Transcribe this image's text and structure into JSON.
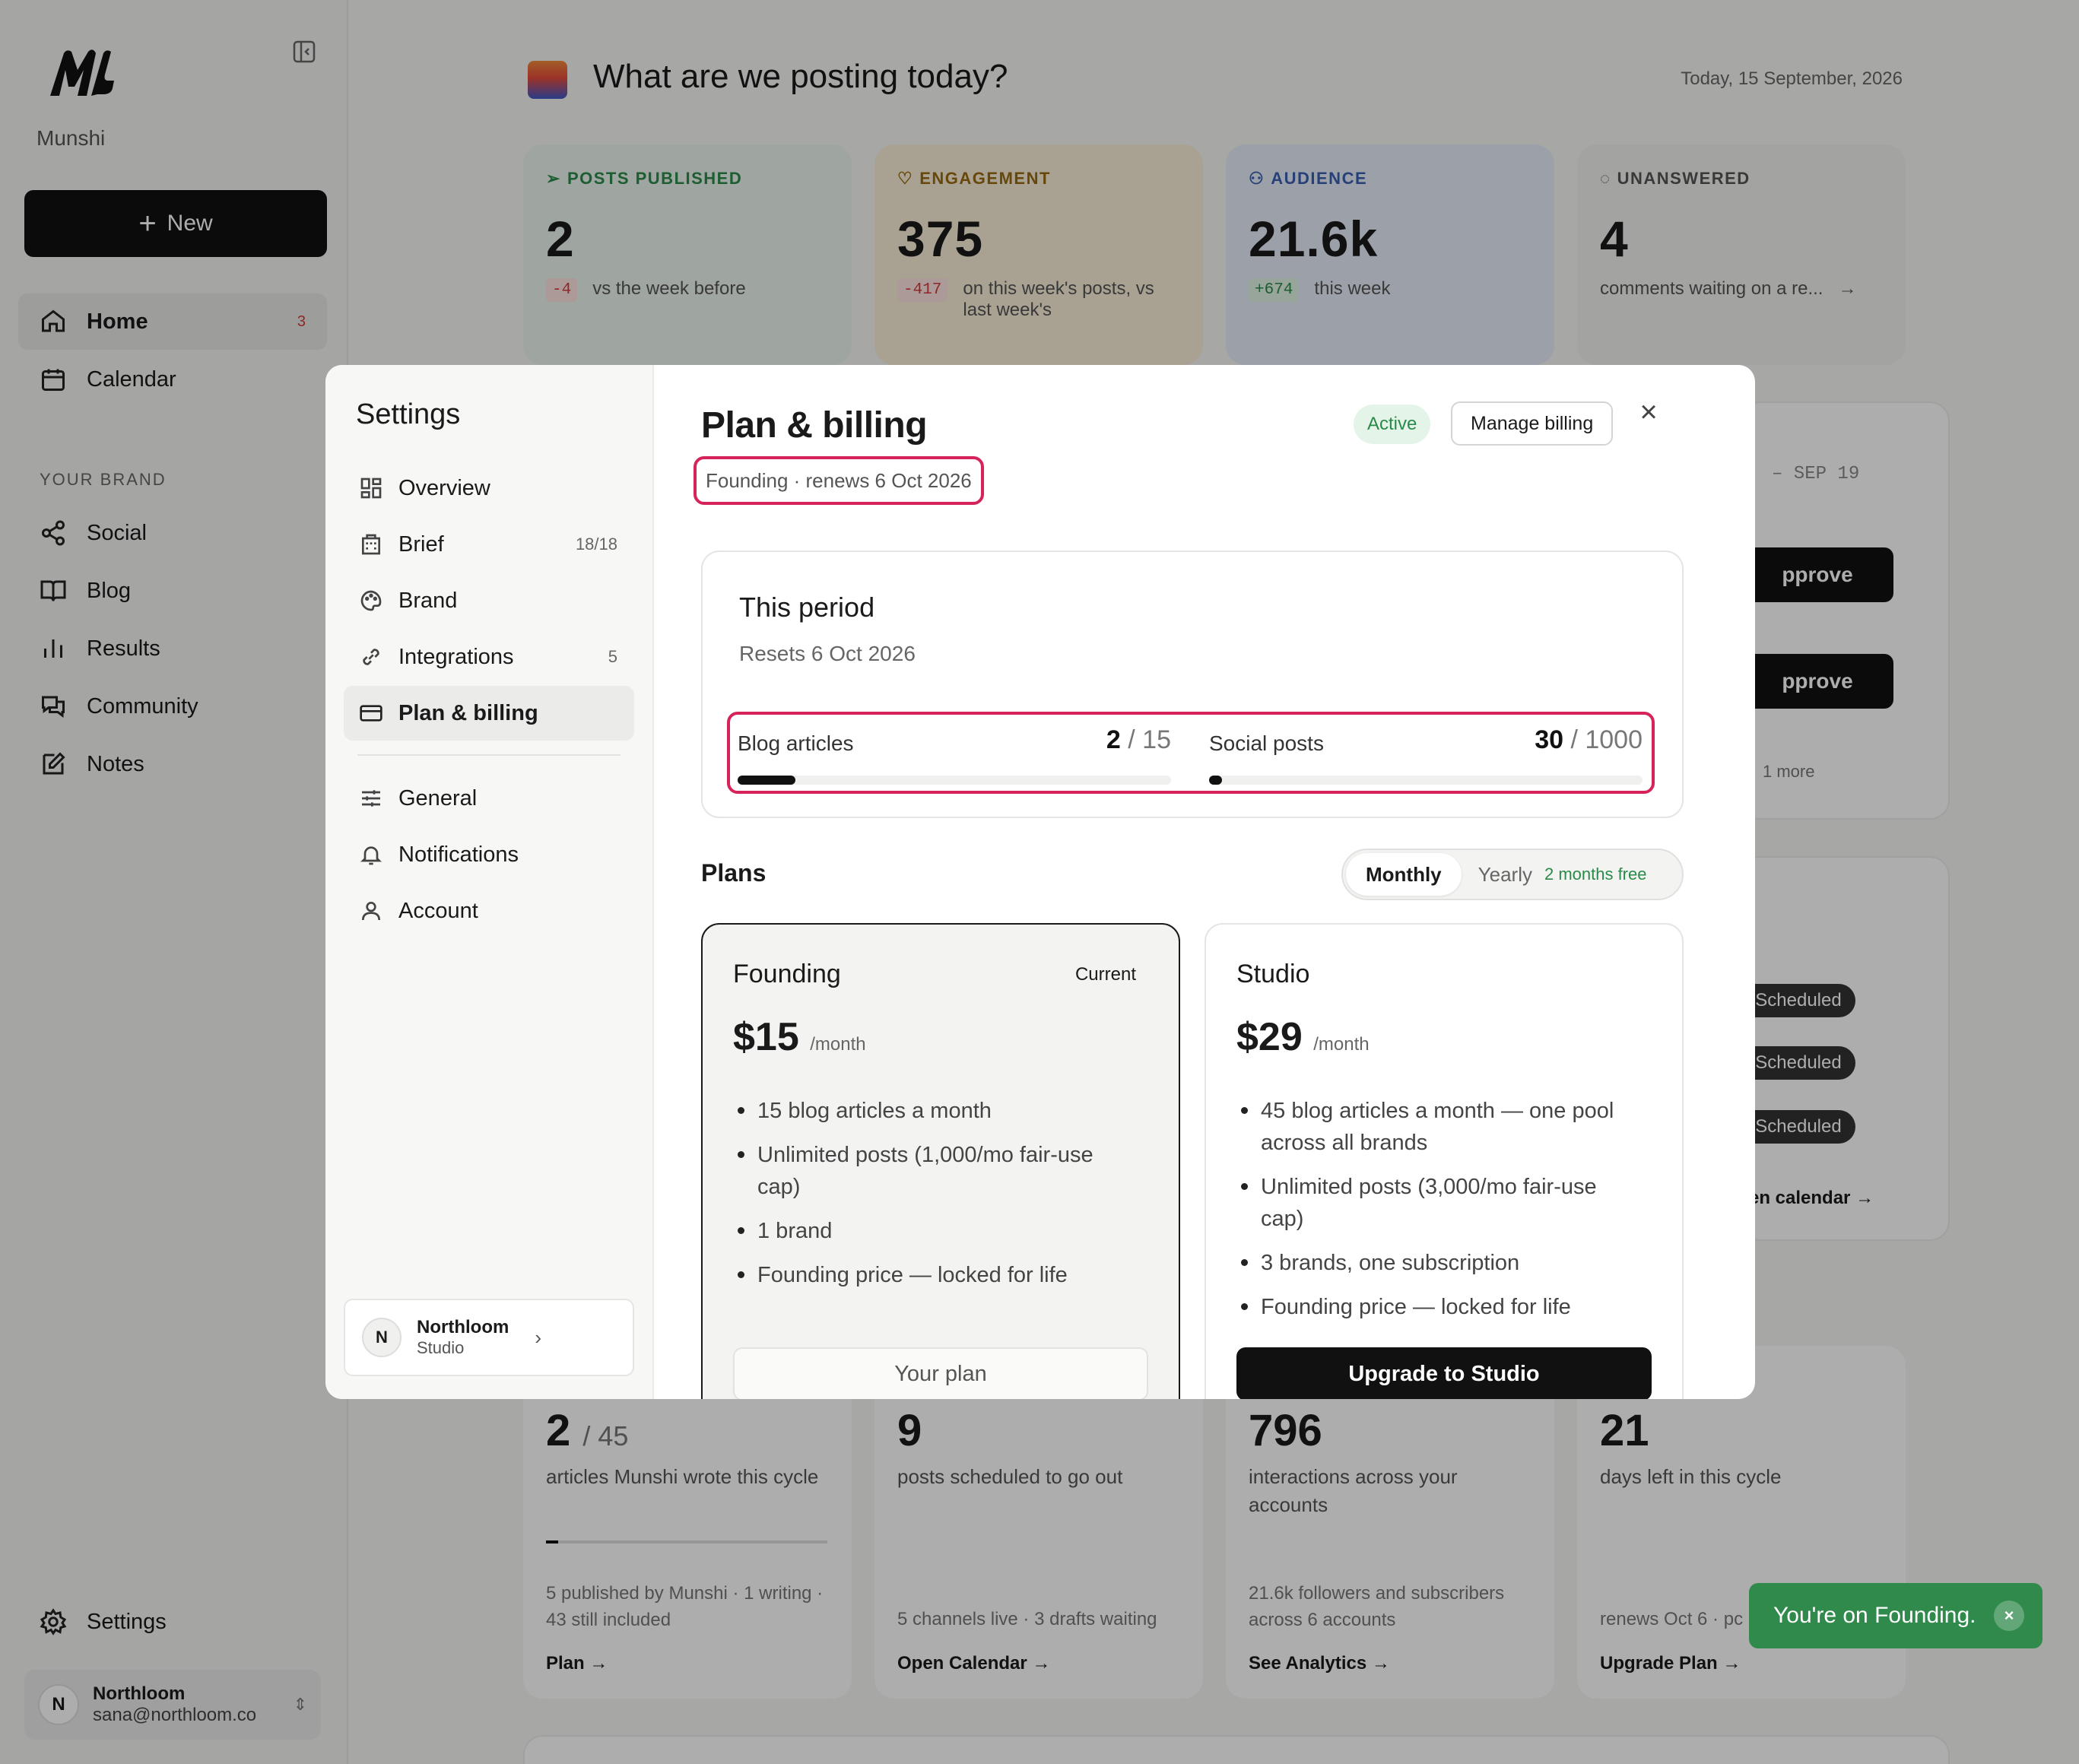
{
  "sidebar": {
    "brand_name": "Munshi",
    "new_label": "New",
    "nav": [
      {
        "label": "Home",
        "icon": "home-icon",
        "badge": "3"
      },
      {
        "label": "Calendar",
        "icon": "calendar-icon"
      }
    ],
    "section_label": "YOUR BRAND",
    "brand_nav": [
      {
        "label": "Social",
        "icon": "share-icon"
      },
      {
        "label": "Blog",
        "icon": "book-icon"
      },
      {
        "label": "Results",
        "icon": "bar-chart-icon"
      },
      {
        "label": "Community",
        "icon": "chat-icon"
      },
      {
        "label": "Notes",
        "icon": "edit-icon"
      }
    ],
    "settings_label": "Settings",
    "user": {
      "initial": "N",
      "name": "Northloom",
      "email": "sana@northloom.co"
    }
  },
  "header": {
    "title": "What are we posting today?",
    "date": "Today, 15 September, 2026"
  },
  "stats": [
    {
      "label": "POSTS PUBLISHED",
      "value": "2",
      "chip": "-4",
      "sub": "vs the week before",
      "color": "#2a8a49",
      "bg": "#eaf3ec"
    },
    {
      "label": "ENGAGEMENT",
      "value": "375",
      "chip": "-417",
      "sub": "on this week's posts, vs last week's",
      "color": "#9a6a10",
      "bg": "#faefd9"
    },
    {
      "label": "AUDIENCE",
      "value": "21.6k",
      "chip": "+674",
      "sub": "this week",
      "color": "#3a5fb0",
      "bg": "#e6eef9"
    },
    {
      "label": "UNANSWERED",
      "value": "4",
      "chip": "",
      "sub": "comments waiting on a re...",
      "color": "#555555",
      "bg": "#f1f1ef"
    }
  ],
  "background_right": {
    "date_range": "– SEP 19",
    "approve_label": "pprove",
    "more_label": "1 more",
    "scheduled_label": "Scheduled",
    "calendar_link": "en calendar →"
  },
  "bottom_cards": [
    {
      "value": "2",
      "value_suffix": "/ 45",
      "desc": "articles Munshi wrote this cycle",
      "foot": "5 published by Munshi · 1 writing · 43 still included",
      "link": "Plan →"
    },
    {
      "value": "9",
      "value_suffix": "",
      "desc": "posts scheduled to go out",
      "foot": "5 channels live · 3 drafts waiting",
      "link": "Open Calendar →"
    },
    {
      "value": "796",
      "value_suffix": "",
      "desc": "interactions across your accounts",
      "foot": "21.6k followers and subscribers across 6 accounts",
      "link": "See Analytics →"
    },
    {
      "value": "21",
      "value_suffix": "",
      "desc": "days left in this cycle",
      "foot": "renews Oct 6 · pc",
      "link": "Upgrade Plan →"
    }
  ],
  "modal": {
    "side_title": "Settings",
    "nav": [
      {
        "label": "Overview",
        "icon": "grid-icon",
        "count": ""
      },
      {
        "label": "Brief",
        "icon": "building-icon",
        "count": "18/18"
      },
      {
        "label": "Brand",
        "icon": "palette-icon",
        "count": ""
      },
      {
        "label": "Integrations",
        "icon": "link-icon",
        "count": "5"
      },
      {
        "label": "Plan & billing",
        "icon": "card-icon",
        "count": ""
      }
    ],
    "nav2": [
      {
        "label": "General",
        "icon": "sliders-icon"
      },
      {
        "label": "Notifications",
        "icon": "bell-icon"
      },
      {
        "label": "Account",
        "icon": "user-icon"
      }
    ],
    "org": {
      "initial": "N",
      "name": "Northloom",
      "sub": "Studio"
    },
    "title": "Plan & billing",
    "subtitle": "Founding · renews 6 Oct 2026",
    "status": "Active",
    "manage_label": "Manage billing",
    "period": {
      "title": "This period",
      "resets": "Resets 6 Oct 2026",
      "usage": [
        {
          "label": "Blog articles",
          "used": "2",
          "total": "/ 15",
          "fraction": 0.133
        },
        {
          "label": "Social posts",
          "used": "30",
          "total": "/ 1000",
          "fraction": 0.03
        }
      ]
    },
    "plans_label": "Plans",
    "billing_toggle": {
      "monthly": "Monthly",
      "yearly": "Yearly",
      "yearly_note": "2 months free"
    },
    "plans": [
      {
        "name": "Founding",
        "tag": "Current",
        "price": "$15",
        "period": "/month",
        "features": [
          "15 blog articles a month",
          "Unlimited posts (1,000/mo fair-use cap)",
          "1 brand",
          "Founding price — locked for life"
        ],
        "button": "Your plan"
      },
      {
        "name": "Studio",
        "tag": "",
        "price": "$29",
        "period": "/month",
        "features": [
          "45 blog articles a month — one pool across all brands",
          "Unlimited posts (3,000/mo fair-use cap)",
          "3 brands, one subscription",
          "Founding price — locked for life"
        ],
        "button": "Upgrade to Studio"
      }
    ]
  },
  "toast": {
    "message": "You're on Founding.",
    "close": "×"
  }
}
